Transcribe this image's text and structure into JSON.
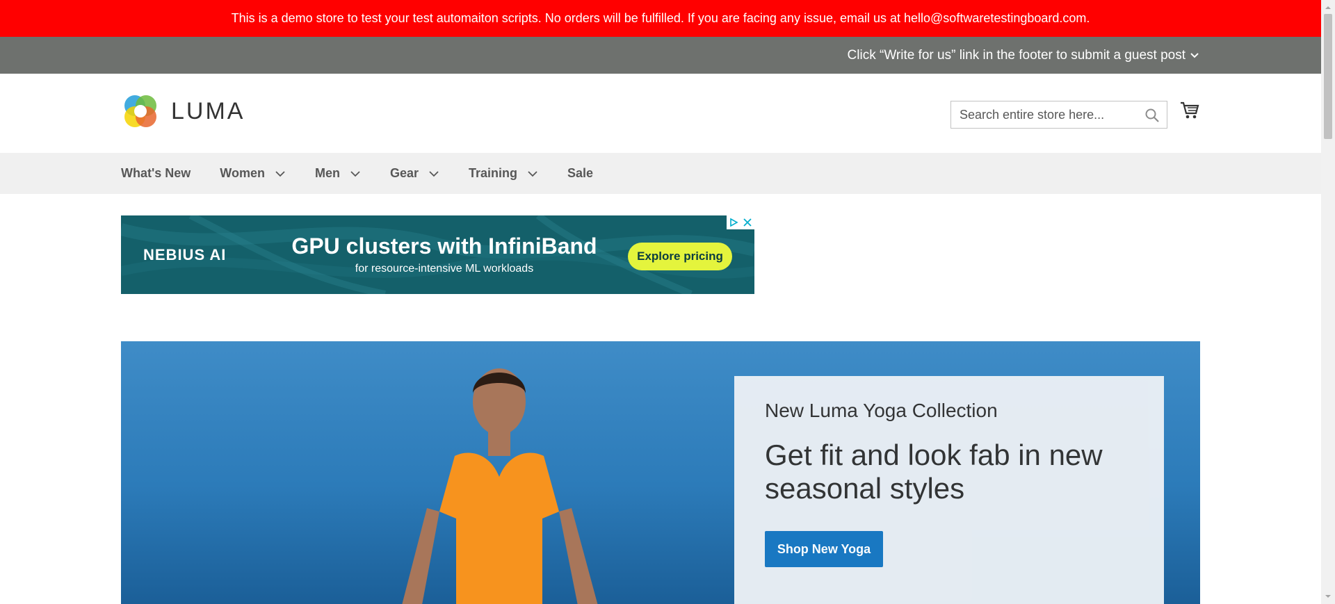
{
  "demo_notice": "This is a demo store to test your test automaiton scripts. No orders will be fulfilled. If you are facing any issue, email us at hello@softwaretestingboard.com.",
  "guest_post": "Click “Write for us” link in the footer to submit a guest post",
  "header": {
    "logo_text": "LUMA",
    "search_placeholder": "Search entire store here...",
    "search_value": ""
  },
  "nav": {
    "items": [
      {
        "label": "What's New",
        "has_dropdown": false
      },
      {
        "label": "Women",
        "has_dropdown": true
      },
      {
        "label": "Men",
        "has_dropdown": true
      },
      {
        "label": "Gear",
        "has_dropdown": true
      },
      {
        "label": "Training",
        "has_dropdown": true
      },
      {
        "label": "Sale",
        "has_dropdown": false
      }
    ]
  },
  "ad": {
    "brand": "NEBIUS AI",
    "headline": "GPU clusters with InfiniBand",
    "subline": "for resource-intensive ML workloads",
    "cta": "Explore pricing"
  },
  "hero": {
    "kicker": "New Luma Yoga Collection",
    "title": "Get fit and look fab in new seasonal styles",
    "button": "Shop New Yoga"
  },
  "colors": {
    "demo_bar": "#ff0000",
    "guest_bar": "#6e716e",
    "nav_bg": "#f0f0f0",
    "primary_button": "#1979c3",
    "ad_bg": "#14606a",
    "ad_cta": "#e4f43d"
  },
  "icons": {
    "search": "search-icon",
    "cart": "cart-icon",
    "chevron": "chevron-down-icon"
  }
}
